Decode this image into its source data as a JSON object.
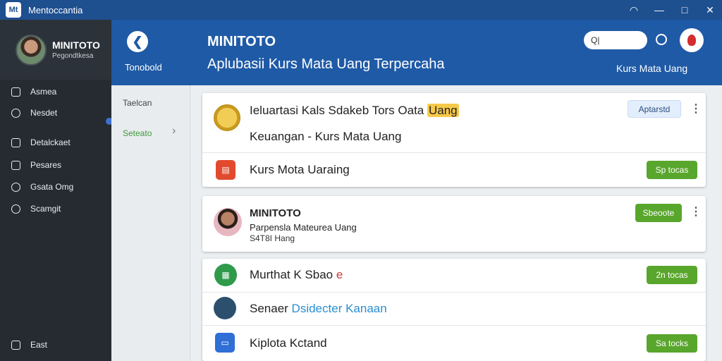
{
  "window": {
    "title": "Mentoccantia",
    "logo_text": "Mt",
    "wifi_symbol": "◠",
    "minimize_symbol": "—",
    "maximize_symbol": "□",
    "close_symbol": "✕"
  },
  "sidebar": {
    "profile_name": "MINITOTO",
    "profile_sub": "Pegondtkesa",
    "items": [
      {
        "label": "Asmea",
        "icon": "bookmark-icon"
      },
      {
        "label": "Nesdet",
        "icon": "chat-icon"
      },
      {
        "label": "Detalckaet",
        "icon": "dashboard-icon"
      },
      {
        "label": "Pesares",
        "icon": "document-icon"
      },
      {
        "label": "Gsata Omg",
        "icon": "search-icon"
      },
      {
        "label": "Scamgit",
        "icon": "settings-icon"
      },
      {
        "label": "East",
        "icon": "exit-icon"
      }
    ]
  },
  "column2": {
    "back_symbol": "❮",
    "header_label": "Tonobold",
    "items": [
      "Taelcan",
      "Seteato"
    ],
    "chevron_symbol": "›"
  },
  "header": {
    "title": "MINITOTO",
    "subtitle": "Aplubasii Kurs Mata Uang Terpercaha",
    "search_placeholder": "Q|",
    "right_label": "Kurs Mata Uang"
  },
  "cards": [
    {
      "title_pre": "Ieluartasi Kals Sdakeb Tors Oata ",
      "title_highlight": "Uang",
      "subtitle": "Keuangan - Kurs Mata Uang",
      "button": "Aptarstd",
      "row2_text": "Kurs Mota Uaraing",
      "row2_button": "Sp tocas",
      "more_symbol": "⋮"
    },
    {
      "name": "MINITOTO",
      "line1": "Parpensla Mateurea Uang",
      "line2": "S4T8I Hang",
      "button": "Sbeoote",
      "more_symbol": "⋮"
    },
    {
      "rows": [
        {
          "text": "Murthat K Sbao ",
          "accent": "e",
          "button": "2n tocas"
        },
        {
          "text": "Senaer ",
          "accent": "Dsidecter Kanaan",
          "button": ""
        },
        {
          "text": "Kiplota Kctand",
          "accent": "",
          "button": "Sa tocks"
        }
      ]
    }
  ],
  "colors": {
    "accent": "#1f5aa6",
    "green": "#59a62c",
    "highlight": "#f7c948"
  }
}
